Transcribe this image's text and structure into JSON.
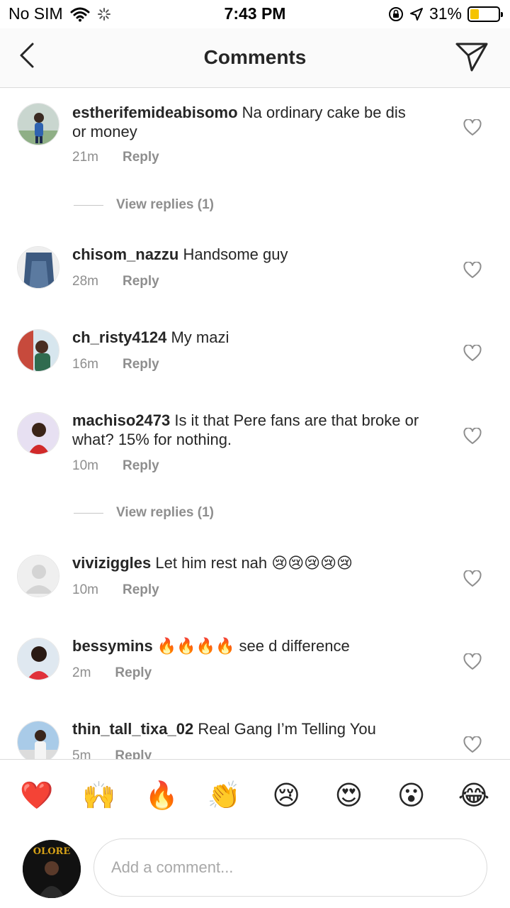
{
  "status_bar": {
    "carrier": "No SIM",
    "time": "7:43 PM",
    "battery_percent": "31%",
    "battery_level": 0.31,
    "icons": [
      "wifi-icon",
      "activity-spinner-icon",
      "orientation-lock-icon",
      "location-arrow-icon",
      "battery-icon"
    ]
  },
  "nav": {
    "title": "Comments",
    "back_icon": "chevron-left-icon",
    "send_icon": "paper-plane-icon"
  },
  "comments": [
    {
      "username": "estherifemideabisomo",
      "text": "Na ordinary cake be dis or money",
      "time": "21m",
      "reply_label": "Reply",
      "view_replies": "View replies (1)"
    },
    {
      "username": "chisom_nazzu",
      "text": "Handsome guy",
      "time": "28m",
      "reply_label": "Reply"
    },
    {
      "username": "ch_risty4124",
      "text": "My mazi",
      "time": "16m",
      "reply_label": "Reply"
    },
    {
      "username": "machiso2473",
      "text": "Is it that Pere fans are that broke or what? 15% for nothing.",
      "time": "10m",
      "reply_label": "Reply",
      "view_replies": "View replies (1)"
    },
    {
      "username": "viviziggles",
      "text": "Let him rest nah 😢😢😢😢😢",
      "time": "10m",
      "reply_label": "Reply"
    },
    {
      "username": "bessymins",
      "text": "🔥🔥🔥🔥 see d difference",
      "time": "2m",
      "reply_label": "Reply"
    },
    {
      "username": "thin_tall_tixa_02",
      "text": "Real Gang I’m Telling You",
      "time": "5m",
      "reply_label": "Reply"
    }
  ],
  "reactions": [
    "❤️",
    "🙌",
    "🔥",
    "👏",
    "😢",
    "😍",
    "😮",
    "😂"
  ],
  "composer": {
    "placeholder": "Add a comment...",
    "avatar_text": "OLORE"
  },
  "colors": {
    "text": "#262626",
    "secondary": "#8e8e8e",
    "divider": "#dbdbdb",
    "battery": "#f5c400"
  }
}
